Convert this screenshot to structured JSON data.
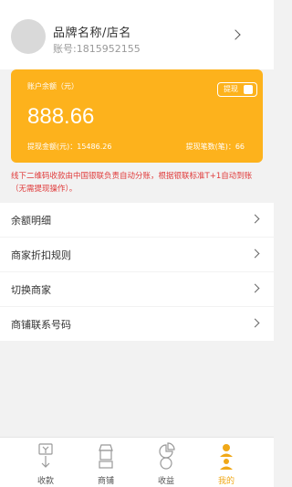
{
  "profile": {
    "brand_name": "品牌名称/店名",
    "account": "账号:1815952155"
  },
  "card": {
    "balance_label": "账户余额（元）",
    "withdraw_label": "提现",
    "balance": "888.66",
    "withdrawn_amount": "提现金额(元)：15486.26",
    "withdraw_count": "提现笔数(笔)：66"
  },
  "notice": "线下二维码收款由中国银联负责自动分账，根据银联标准T+1自动到账（无需提现操作）。",
  "menu": [
    {
      "label": "余额明细"
    },
    {
      "label": "商家折扣规则"
    },
    {
      "label": "切换商家"
    },
    {
      "label": "商铺联系号码"
    }
  ],
  "tabs": [
    {
      "label": "收款",
      "icon": "payment-icon"
    },
    {
      "label": "商铺",
      "icon": "shop-icon"
    },
    {
      "label": "收益",
      "icon": "pie-chart-icon"
    },
    {
      "label": "我的",
      "icon": "user-icon"
    }
  ],
  "colors": {
    "accent": "#fdb21c",
    "notice": "#e03a3a",
    "active_tab": "#f0a818"
  }
}
